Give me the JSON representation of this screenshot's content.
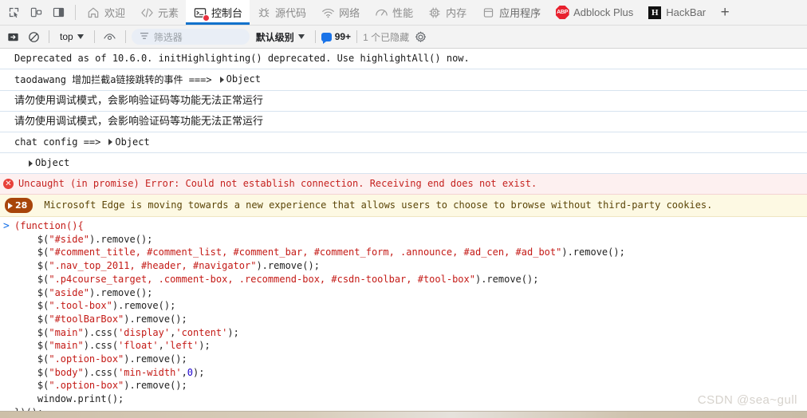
{
  "tabbar": {
    "left_icons": [
      {
        "name": "inspect-element-icon"
      },
      {
        "name": "device-toolbar-icon"
      },
      {
        "name": "dock-side-icon"
      }
    ],
    "tabs": [
      {
        "label": "欢迎",
        "icon": "home-icon",
        "active": false,
        "kind": "panel"
      },
      {
        "label": "元素",
        "icon": "code-brackets-icon",
        "active": false,
        "kind": "panel"
      },
      {
        "label": "控制台",
        "icon": "console-terminal-icon",
        "active": true,
        "kind": "panel"
      },
      {
        "label": "源代码",
        "icon": "bug-icon",
        "active": false,
        "kind": "panel"
      },
      {
        "label": "网络",
        "icon": "network-wifi-icon",
        "active": false,
        "kind": "panel"
      },
      {
        "label": "性能",
        "icon": "performance-gauge-icon",
        "active": false,
        "kind": "panel"
      },
      {
        "label": "内存",
        "icon": "memory-chip-icon",
        "active": false,
        "kind": "panel"
      },
      {
        "label": "应用程序",
        "icon": "application-database-icon",
        "active": false,
        "kind": "panel"
      },
      {
        "label": "Adblock Plus",
        "icon": "abp-logo-icon",
        "active": false,
        "kind": "extension",
        "badge_text": "ABP"
      },
      {
        "label": "HackBar",
        "icon": "hackbar-logo-icon",
        "active": false,
        "kind": "extension",
        "badge_text": "H"
      }
    ],
    "new_tab_label": "+"
  },
  "console_toolbar": {
    "sidebar_toggle_icon": "console-sidebar-icon",
    "clear_icon": "clear-console-icon",
    "context_value": "top",
    "eye_icon": "live-expression-icon",
    "filter_placeholder": "筛选器",
    "filter_value": "",
    "filter_icon": "filter-funnel-icon",
    "level_label": "默认级别",
    "message_count": "99+",
    "hidden_label": "1 个已隐藏",
    "settings_icon": "gear-icon"
  },
  "console_rows": [
    {
      "type": "log",
      "text": "Deprecated as of 10.6.0. initHighlighting() deprecated.  Use highlightAll() now.",
      "mono": true
    },
    {
      "type": "log",
      "text": "taodawang 增加拦截a链接跳转的事件 ===>",
      "mono": true,
      "object_label": "Object"
    },
    {
      "type": "log",
      "text": "请勿使用调试模式，会影响验证码等功能无法正常运行",
      "mono": false
    },
    {
      "type": "log",
      "text": "请勿使用调试模式，会影响验证码等功能无法正常运行",
      "mono": false
    },
    {
      "type": "log",
      "text": "chat config ==>",
      "mono": true,
      "object_label": "Object"
    },
    {
      "type": "log",
      "text": "",
      "mono": true,
      "object_label": "Object",
      "indent": true
    },
    {
      "type": "error",
      "text": "Uncaught (in promise) Error: Could not establish connection. Receiving end does not exist.",
      "icon": "error-circle-icon"
    },
    {
      "type": "warning",
      "text": "Microsoft Edge is moving towards a new experience that allows users to choose to browse without third-party cookies.",
      "badge_count": "28"
    }
  ],
  "prompt": {
    "chevron": ">",
    "code_lines": [
      [
        {
          "t": "(function(){",
          "c": "s"
        }
      ],
      [
        {
          "t": "    $(",
          "c": "d"
        },
        {
          "t": "\"#side\"",
          "c": "s"
        },
        {
          "t": ").remove();",
          "c": "d"
        }
      ],
      [
        {
          "t": "    $(",
          "c": "d"
        },
        {
          "t": "\"#comment_title, #comment_list, #comment_bar, #comment_form, .announce, #ad_cen, #ad_bot\"",
          "c": "s"
        },
        {
          "t": ").remove();",
          "c": "d"
        }
      ],
      [
        {
          "t": "    $(",
          "c": "d"
        },
        {
          "t": "\".nav_top_2011, #header, #navigator\"",
          "c": "s"
        },
        {
          "t": ").remove();",
          "c": "d"
        }
      ],
      [
        {
          "t": "    $(",
          "c": "d"
        },
        {
          "t": "\".p4course_target, .comment-box, .recommend-box, #csdn-toolbar, #tool-box\"",
          "c": "s"
        },
        {
          "t": ").remove();",
          "c": "d"
        }
      ],
      [
        {
          "t": "    $(",
          "c": "d"
        },
        {
          "t": "\"aside\"",
          "c": "s"
        },
        {
          "t": ").remove();",
          "c": "d"
        }
      ],
      [
        {
          "t": "    $(",
          "c": "d"
        },
        {
          "t": "\".tool-box\"",
          "c": "s"
        },
        {
          "t": ").remove();",
          "c": "d"
        }
      ],
      [
        {
          "t": "    $(",
          "c": "d"
        },
        {
          "t": "\"#toolBarBox\"",
          "c": "s"
        },
        {
          "t": ").remove();",
          "c": "d"
        }
      ],
      [
        {
          "t": "    $(",
          "c": "d"
        },
        {
          "t": "\"main\"",
          "c": "s"
        },
        {
          "t": ").css(",
          "c": "d"
        },
        {
          "t": "'display'",
          "c": "s"
        },
        {
          "t": ",",
          "c": "d"
        },
        {
          "t": "'content'",
          "c": "s"
        },
        {
          "t": ");",
          "c": "d"
        }
      ],
      [
        {
          "t": "    $(",
          "c": "d"
        },
        {
          "t": "\"main\"",
          "c": "s"
        },
        {
          "t": ").css(",
          "c": "d"
        },
        {
          "t": "'float'",
          "c": "s"
        },
        {
          "t": ",",
          "c": "d"
        },
        {
          "t": "'left'",
          "c": "s"
        },
        {
          "t": ");",
          "c": "d"
        }
      ],
      [
        {
          "t": "    $(",
          "c": "d"
        },
        {
          "t": "\".option-box\"",
          "c": "s"
        },
        {
          "t": ").remove();",
          "c": "d"
        }
      ],
      [
        {
          "t": "    $(",
          "c": "d"
        },
        {
          "t": "\"body\"",
          "c": "s"
        },
        {
          "t": ").css(",
          "c": "d"
        },
        {
          "t": "'min-width'",
          "c": "s"
        },
        {
          "t": ",",
          "c": "d"
        },
        {
          "t": "0",
          "c": "n"
        },
        {
          "t": ");",
          "c": "d"
        }
      ],
      [
        {
          "t": "    $(",
          "c": "d"
        },
        {
          "t": "\".option-box\"",
          "c": "s"
        },
        {
          "t": ").remove();",
          "c": "d"
        }
      ],
      [
        {
          "t": "    window.print();",
          "c": "d"
        }
      ],
      [
        {
          "t": "})();",
          "c": "d"
        }
      ]
    ]
  },
  "watermark": "CSDN @sea~gull"
}
